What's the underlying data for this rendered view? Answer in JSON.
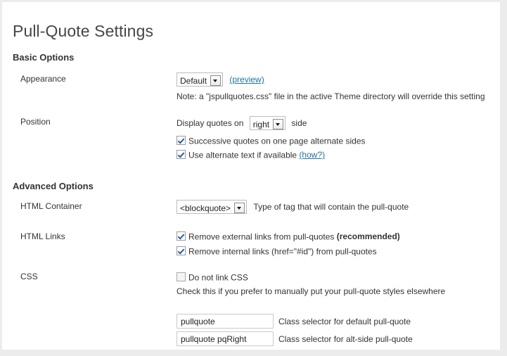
{
  "page": {
    "title": "Pull-Quote Settings"
  },
  "sections": {
    "basic": {
      "heading": "Basic Options",
      "appearance": {
        "label": "Appearance",
        "select_value": "Default",
        "preview_link": "(preview)",
        "note": "Note: a \"jspullquotes.css\" file in the active Theme directory will override this setting"
      },
      "position": {
        "label": "Position",
        "prefix_text": "Display quotes on",
        "select_value": "right",
        "suffix_text": "side",
        "checkbox_alternate_sides": {
          "label": "Successive quotes on one page alternate sides",
          "checked": true
        },
        "checkbox_alternate_text": {
          "label": "Use alternate text if available",
          "link": "(how?)",
          "checked": true
        }
      }
    },
    "advanced": {
      "heading": "Advanced Options",
      "html_container": {
        "label": "HTML Container",
        "select_value": "<blockquote>",
        "description": "Type of tag that will contain the pull-quote"
      },
      "html_links": {
        "label": "HTML Links",
        "checkbox_external": {
          "label": "Remove external links from pull-quotes",
          "emphasis": "(recommended)",
          "checked": true
        },
        "checkbox_internal": {
          "label": "Remove internal links (href=\"#id\") from pull-quotes",
          "checked": true
        }
      },
      "css": {
        "label": "CSS",
        "checkbox_do_not_link": {
          "label": "Do not link CSS",
          "checked": false
        },
        "hint": "Check this if you prefer to manually put your pull-quote styles elsewhere",
        "default_selector": {
          "value": "pullquote",
          "description": "Class selector for default pull-quote"
        },
        "alt_selector": {
          "value": "pullquote pqRight",
          "description": "Class selector for alt-side pull-quote"
        }
      }
    }
  },
  "colors": {
    "link": "#21759b",
    "title": "#464646",
    "text": "#333333",
    "page_bg": "#ececec"
  }
}
